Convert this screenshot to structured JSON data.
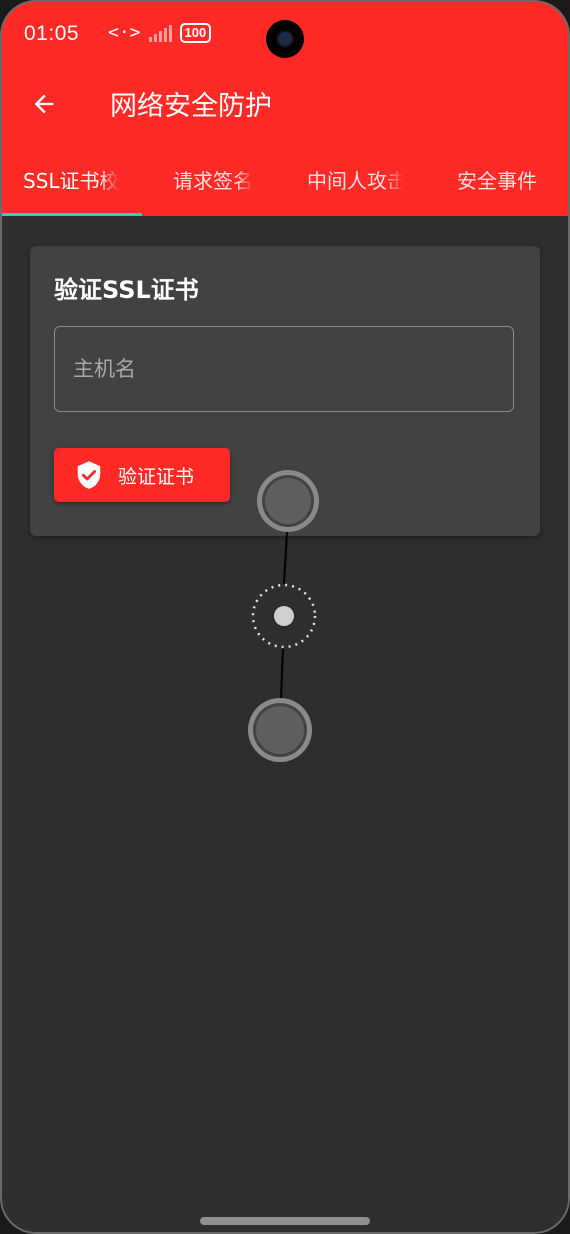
{
  "status_bar": {
    "time": "01:05",
    "data_icon": "<·>",
    "battery": "100"
  },
  "app_bar": {
    "title": "网络安全防护"
  },
  "tabs": [
    {
      "label": "SSL证书校验",
      "active": true
    },
    {
      "label": "请求签名",
      "active": false
    },
    {
      "label": "中间人攻击检测",
      "active": false
    },
    {
      "label": "安全事件",
      "active": false
    }
  ],
  "card": {
    "title": "验证SSL证书",
    "host_input": {
      "placeholder": "主机名",
      "value": ""
    },
    "verify_button": "验证证书"
  },
  "colors": {
    "accent": "#ff2a26",
    "tab_indicator": "#2fcfb5",
    "background": "#2e2e2e",
    "card": "#424242"
  },
  "icons": {
    "back": "arrow-left-icon",
    "verify": "shield-check-icon",
    "signal": "signal-bars-icon",
    "battery": "battery-icon"
  }
}
